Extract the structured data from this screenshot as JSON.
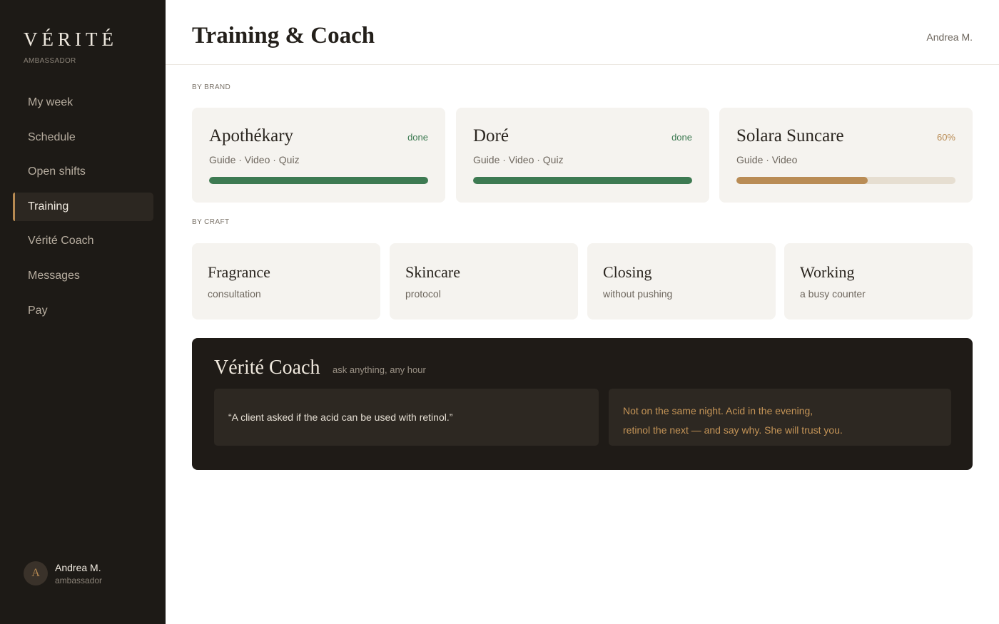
{
  "sidebar": {
    "brand": "VÉRITÉ",
    "brand_sub": "AMBASSADOR",
    "items": [
      {
        "label": "My week"
      },
      {
        "label": "Schedule"
      },
      {
        "label": "Open shifts"
      },
      {
        "label": "Training"
      },
      {
        "label": "Vérité Coach"
      },
      {
        "label": "Messages"
      },
      {
        "label": "Pay"
      }
    ],
    "user": {
      "initial": "A",
      "name": "Andrea M.",
      "role": "ambassador"
    }
  },
  "header": {
    "title": "Training & Coach",
    "user": "Andrea M."
  },
  "by_brand": {
    "label": "BY BRAND",
    "cards": [
      {
        "name": "Apothékary",
        "status": "done",
        "modules": "Guide · Video · Quiz",
        "progress": 1.0,
        "color": "#3d7a52"
      },
      {
        "name": "Doré",
        "status": "done",
        "modules": "Guide · Video · Quiz",
        "progress": 1.0,
        "color": "#3d7a52"
      },
      {
        "name": "Solara Suncare",
        "status": "60%",
        "modules": "Guide · Video",
        "progress": 0.6,
        "color": "#b98c55"
      }
    ]
  },
  "by_craft": {
    "label": "BY CRAFT",
    "cards": [
      {
        "title": "Fragrance",
        "subtitle": "consultation"
      },
      {
        "title": "Skincare",
        "subtitle": "protocol"
      },
      {
        "title": "Closing",
        "subtitle": "without pushing"
      },
      {
        "title": "Working",
        "subtitle": "a busy counter"
      }
    ]
  },
  "coach": {
    "title": "Vérité Coach",
    "subtitle": "ask anything, any hour",
    "question": "“A client asked if the acid can be used with retinol.”",
    "answer_line1": "Not on the same night. Acid in the evening,",
    "answer_line2": "retinol the next — and say why. She will trust you."
  },
  "colors": {
    "accent": "#b78a52",
    "done": "#3d7a52",
    "sidebar_bg": "#1d1a16"
  }
}
